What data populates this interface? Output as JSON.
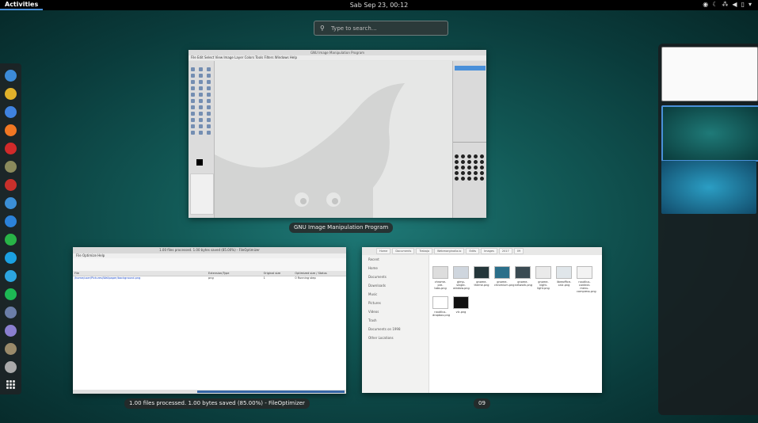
{
  "topbar": {
    "activities": "Activities",
    "clock": "Sab Sep 23, 00:12"
  },
  "search": {
    "placeholder": "Type to search…"
  },
  "dash": {
    "apps": [
      {
        "name": "files",
        "color": "#3c8bd9"
      },
      {
        "name": "chrome",
        "color": "#e0b12a"
      },
      {
        "name": "chromium",
        "color": "#3f82e0"
      },
      {
        "name": "firefox",
        "color": "#f17723"
      },
      {
        "name": "opera",
        "color": "#d12a2a"
      },
      {
        "name": "gimp",
        "color": "#8a8a5c"
      },
      {
        "name": "filezilla",
        "color": "#c8302b"
      },
      {
        "name": "image-viewer",
        "color": "#3b8fd6"
      },
      {
        "name": "vscode",
        "color": "#2b82d9"
      },
      {
        "name": "line",
        "color": "#28b447"
      },
      {
        "name": "skype",
        "color": "#1ba1e2"
      },
      {
        "name": "telegram",
        "color": "#2ca5e0"
      },
      {
        "name": "spotify",
        "color": "#1db954"
      },
      {
        "name": "disks",
        "color": "#6b7ea8"
      },
      {
        "name": "gem",
        "color": "#8a7fd0"
      },
      {
        "name": "hammer",
        "color": "#9a8a6a"
      },
      {
        "name": "tools",
        "color": "#aaaaaa"
      }
    ]
  },
  "windows": {
    "gimp": {
      "title": "GNU Image Manipulation Program",
      "menu": "File  Edit  Select  View  Image  Layer  Colors  Tools  Filters  Windows  Help"
    },
    "fileoptimizer": {
      "title": "1.00 files processed. 1.00 bytes saved (85.00%) - FileOptimizer",
      "menu": "File  Optimize  Help",
      "columns": [
        "File",
        "Extension/Type",
        "Original size",
        "Optimized size / Status"
      ],
      "row": [
        "/home/user/Pictures/Wallpaper/background.png",
        "png",
        "1",
        "0 Running step"
      ]
    },
    "files": {
      "path": [
        "Home",
        "Documents",
        "Trabajo",
        "Webmarginalia.io",
        "Edits",
        "Images",
        "2017",
        "09"
      ],
      "sidebar": [
        "Recent",
        "Home",
        "Documents",
        "Downloads",
        "Music",
        "Pictures",
        "Videos",
        "Trash",
        "Documents on 1998",
        "Other Locations"
      ],
      "items": [
        "chrome-pre-tabs.png",
        "gimp-single-window.png",
        "gnome-theme.png",
        "gnome-chromium.png",
        "gnome-network.png",
        "gnome-night-light.png",
        "libreoffice-calc.png",
        "nautilus-context-menu-compress.png",
        "nautilus-dropbox.png",
        "vlc.png"
      ],
      "caption": "09"
    }
  },
  "colors": {
    "accent": "#4a90d9",
    "topbar": "#000000"
  }
}
